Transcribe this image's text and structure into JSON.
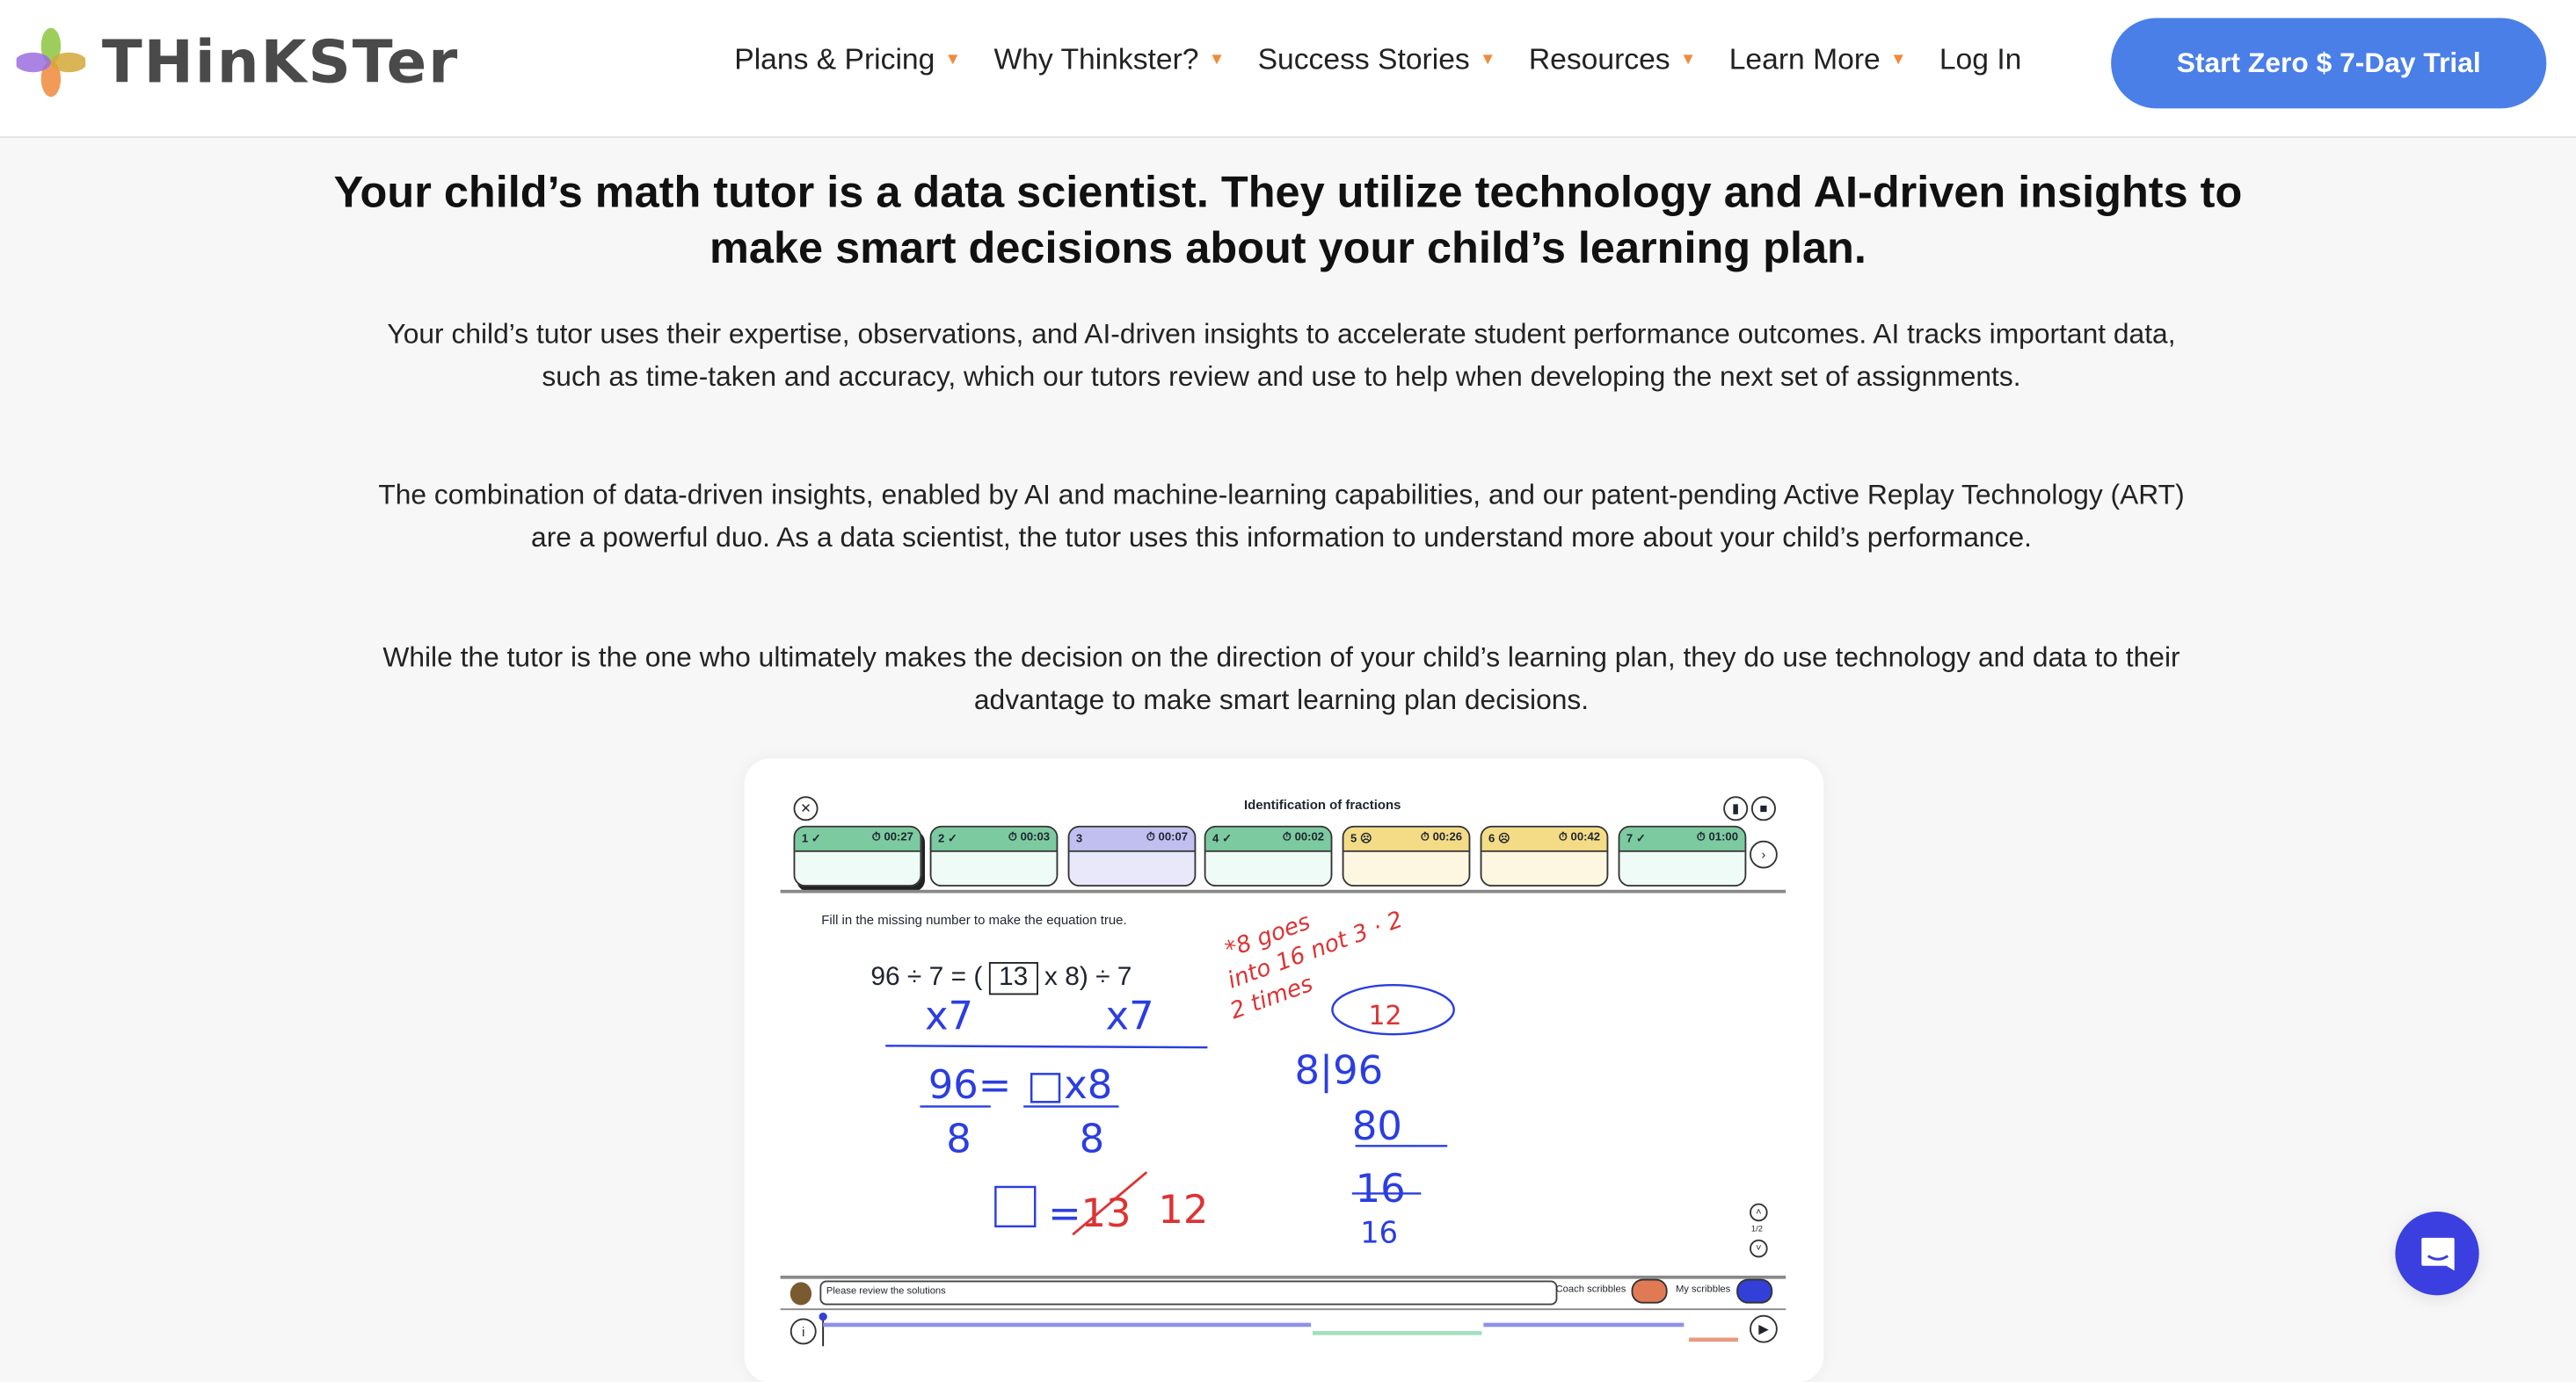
{
  "header": {
    "logo_text": "THinKSTer",
    "nav": [
      {
        "label": "Plans & Pricing"
      },
      {
        "label": "Why Thinkster?"
      },
      {
        "label": "Success Stories"
      },
      {
        "label": "Resources"
      },
      {
        "label": "Learn More"
      }
    ],
    "login": "Log In",
    "cta": "Start Zero $ 7-Day Trial",
    "colors": {
      "accent": "#4a7fe8",
      "caret": "#f08a3c"
    }
  },
  "main": {
    "headline": "Your child’s math tutor is a data scientist. They utilize technology and AI-driven insights to make smart decisions about your child’s learning plan.",
    "paragraphs": [
      "Your child’s tutor uses their expertise, observations, and AI-driven insights to accelerate student performance outcomes. AI tracks important data, such as time-taken and accuracy, which our tutors review and use to help when developing the next set of assignments.",
      "The combination of data-driven insights, enabled by AI and machine-learning capabilities, and our patent-pending Active Replay Technology (ART) are a powerful duo. As a data scientist, the tutor uses this information to understand more about your child’s performance.",
      "While the tutor is the one who ultimately makes the decision on the direction of your child’s learning plan, they do use technology and data to their advantage to make smart learning plan decisions."
    ]
  },
  "app": {
    "title": "Identification of fractions",
    "tabs": [
      {
        "num": "1",
        "status": "✓",
        "time": "00:27",
        "color": "#7ccaa0",
        "body": "#eefbf6"
      },
      {
        "num": "2",
        "status": "✓",
        "time": "00:03",
        "color": "#7ccaa0",
        "body": "#eefbf6"
      },
      {
        "num": "3",
        "status": "",
        "time": "00:07",
        "color": "#c0bff0",
        "body": "#e9e8fb"
      },
      {
        "num": "4",
        "status": "✓",
        "time": "00:02",
        "color": "#7ccaa0",
        "body": "#eefbf6"
      },
      {
        "num": "5",
        "status": "☹",
        "time": "00:26",
        "color": "#f4dc86",
        "body": "#fdf7e2"
      },
      {
        "num": "6",
        "status": "☹",
        "time": "00:42",
        "color": "#f4dc86",
        "body": "#fdf7e2"
      },
      {
        "num": "7",
        "status": "✓",
        "time": "01:00",
        "color": "#7ccaa0",
        "body": "#eefbf6"
      }
    ],
    "instruction": "Fill in the missing number to make the equation true.",
    "equation_left": "96 ÷ 7 = (",
    "equation_box": "13",
    "equation_right": "x 8) ÷ 7",
    "handwriting": {
      "red_note": "*8 goes into 16 not 3 2 times",
      "blue_x7": "x7",
      "blue_frac": "96= □x8",
      "blue_denoms": "8 8",
      "blue_box": "□=",
      "red_13": "13",
      "red_12": "12",
      "blue_div": "8|96",
      "blue_80": "80",
      "blue_16": "16",
      "blue_ans": "12"
    },
    "page_indicator": "1/2",
    "comment": "Please review the solutions",
    "coach_scribbles": "Coach scribbles",
    "my_scribbles": "My scribbles"
  }
}
